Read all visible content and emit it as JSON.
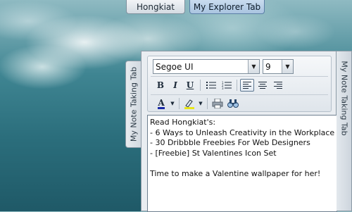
{
  "tabs": {
    "top": [
      {
        "label": "Hongkiat",
        "active": false
      },
      {
        "label": "My Explorer Tab",
        "active": true
      }
    ],
    "left_side_label": "My Note Taking Tab",
    "right_side_label": "My Note Taking Tab"
  },
  "toolbar": {
    "font_value": "Segoe UI",
    "size_value": "9",
    "bold_label": "B",
    "italic_label": "I",
    "underline_label": "U",
    "font_color_label": "A",
    "highlight_label": "ab",
    "icons": [
      "bold-icon",
      "italic-icon",
      "underline-icon",
      "bullet-list-icon",
      "numbered-list-icon",
      "align-left-icon",
      "align-center-icon",
      "align-right-icon",
      "font-color-icon",
      "highlight-icon",
      "print-icon",
      "find-icon"
    ],
    "colors": {
      "font_color": "#1a2aa8",
      "highlight_color": "#e8e61a"
    }
  },
  "note": {
    "lines": [
      "Read Hongkiat's:",
      "- 6 Ways to Unleash Creativity in the Workplace",
      "- 30 Dribbble Freebies For Web Designers",
      "- [Freebie] St Valentines Icon Set",
      "",
      "Time to make a Valentine wallpaper for her!"
    ]
  }
}
